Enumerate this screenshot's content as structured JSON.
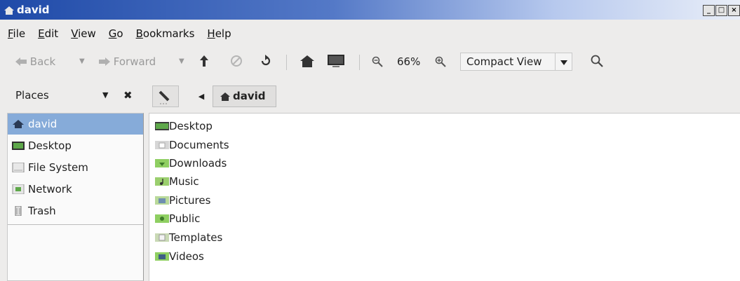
{
  "window": {
    "title": "david",
    "controls": [
      "_",
      "□",
      "×"
    ]
  },
  "menubar": {
    "items": [
      {
        "mnemonic": "F",
        "rest": "ile"
      },
      {
        "mnemonic": "E",
        "rest": "dit"
      },
      {
        "mnemonic": "V",
        "rest": "iew"
      },
      {
        "mnemonic": "G",
        "rest": "o"
      },
      {
        "mnemonic": "B",
        "rest": "ookmarks"
      },
      {
        "mnemonic": "H",
        "rest": "elp"
      }
    ]
  },
  "toolbar": {
    "back_label": "Back",
    "forward_label": "Forward",
    "zoom_level": "66%",
    "view_mode": "Compact View"
  },
  "places": {
    "title": "Places",
    "items": [
      {
        "label": "david",
        "icon": "home-icon",
        "selected": true
      },
      {
        "label": "Desktop",
        "icon": "desktop-icon"
      },
      {
        "label": "File System",
        "icon": "drive-icon"
      },
      {
        "label": "Network",
        "icon": "network-icon"
      },
      {
        "label": "Trash",
        "icon": "trash-icon"
      }
    ]
  },
  "pathbar": {
    "current": "david"
  },
  "files": [
    {
      "name": "Desktop",
      "icon": "desktop-folder-icon"
    },
    {
      "name": "Documents",
      "icon": "documents-folder-icon"
    },
    {
      "name": "Downloads",
      "icon": "downloads-folder-icon"
    },
    {
      "name": "Music",
      "icon": "music-folder-icon"
    },
    {
      "name": "Pictures",
      "icon": "pictures-folder-icon"
    },
    {
      "name": "Public",
      "icon": "public-folder-icon"
    },
    {
      "name": "Templates",
      "icon": "templates-folder-icon"
    },
    {
      "name": "Videos",
      "icon": "videos-folder-icon"
    }
  ],
  "colors": {
    "titlebar": "#1f4aa8",
    "selection": "#86abd9",
    "folder_green": "#5ea84a"
  }
}
